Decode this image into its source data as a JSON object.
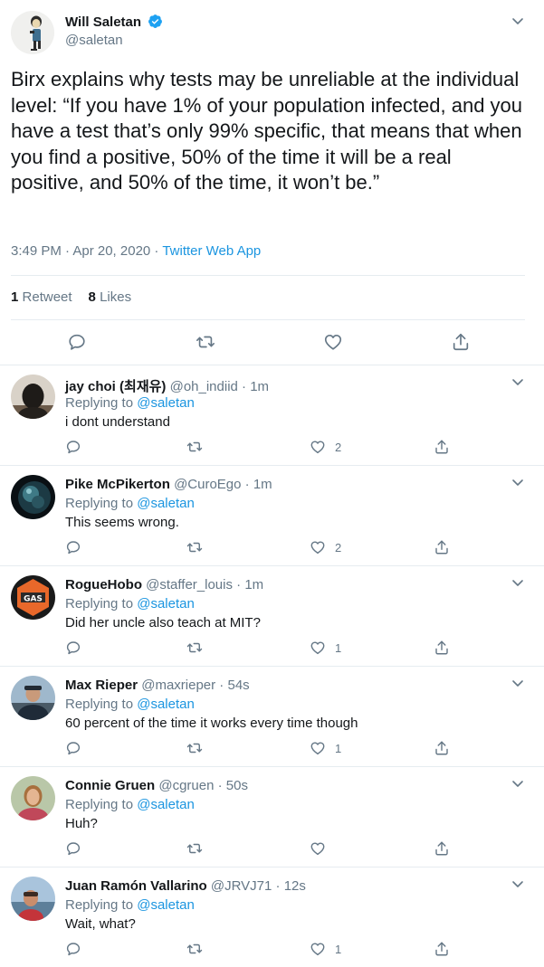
{
  "tweet": {
    "author_name": "Will Saletan",
    "author_handle": "@saletan",
    "text": "Birx explains why tests may be unreliable at the individual level: “If you have 1% of your population infected, and you have a test that’s only 99% specific, that means that when you find a positive, 50% of the time it will be a real positive, and 50% of the time, it won’t be.”",
    "time": "3:49 PM · Apr 20, 2020 · ",
    "source": "Twitter Web App",
    "retweet_count": "1",
    "retweet_label": "Retweet",
    "like_count": "8",
    "like_label": "Likes"
  },
  "replies": [
    {
      "name": "jay choi (최재유)",
      "handle": "@oh_indiid",
      "dot": " · ",
      "time": "1m",
      "replying_prefix": "Replying to ",
      "replying_to": "@saletan",
      "text": "i dont understand",
      "likes": "2"
    },
    {
      "name": "Pike McPikerton",
      "handle": "@CuroEgo",
      "dot": " · ",
      "time": "1m",
      "replying_prefix": "Replying to ",
      "replying_to": "@saletan",
      "text": "This seems wrong.",
      "likes": "2"
    },
    {
      "name": "RogueHobo",
      "handle": "@staffer_louis",
      "dot": " · ",
      "time": "1m",
      "replying_prefix": "Replying to ",
      "replying_to": "@saletan",
      "text": "Did her uncle also teach at MIT?",
      "likes": "1"
    },
    {
      "name": "Max Rieper",
      "handle": "@maxrieper",
      "dot": " · ",
      "time": "54s",
      "replying_prefix": "Replying to ",
      "replying_to": "@saletan",
      "text": "60 percent of the time it works every time though",
      "likes": "1"
    },
    {
      "name": "Connie Gruen",
      "handle": "@cgruen",
      "dot": " · ",
      "time": "50s",
      "replying_prefix": "Replying to ",
      "replying_to": "@saletan",
      "text": "Huh?",
      "likes": ""
    },
    {
      "name": "Juan Ramón Vallarino",
      "handle": "@JRVJ71",
      "dot": " · ",
      "time": "12s",
      "replying_prefix": "Replying to ",
      "replying_to": "@saletan",
      "text": "Wait, what?",
      "likes": "1"
    }
  ],
  "colors": {
    "link": "#1b95e0",
    "muted": "#657786",
    "text": "#14171a",
    "border": "#e6ecf0",
    "verified": "#1da1f2"
  },
  "icons": [
    "chevron-down-icon",
    "verified-badge-icon",
    "reply-icon",
    "retweet-icon",
    "like-icon",
    "share-icon"
  ]
}
